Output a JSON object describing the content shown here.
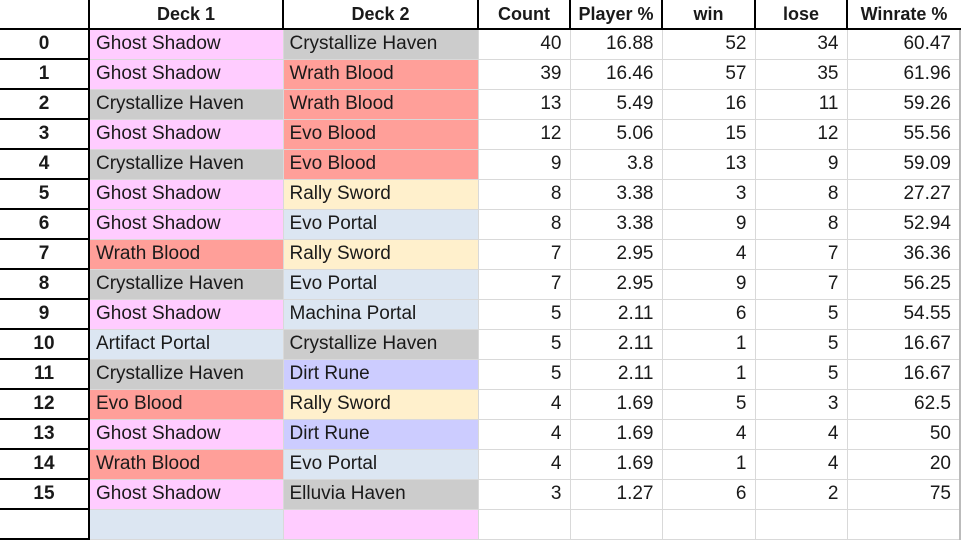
{
  "columns": [
    "",
    "Deck 1",
    "Deck 2",
    "Count",
    "Player %",
    "win",
    "lose",
    "Winrate %"
  ],
  "deck_colors": {
    "Ghost Shadow": "#ffccff",
    "Crystallize Haven": "#cccccc",
    "Wrath Blood": "#ff9f99",
    "Evo Blood": "#ff9f99",
    "Rally Sword": "#fff0cc",
    "Evo Portal": "#dce6f2",
    "Machina Portal": "#dce6f2",
    "Artifact Portal": "#dce6f2",
    "Dirt Rune": "#ccccff",
    "Elluvia Haven": "#cccccc"
  },
  "rows": [
    {
      "index": "0",
      "deck1": "Ghost Shadow",
      "deck2": "Crystallize Haven",
      "count": "40",
      "player_pct": "16.88",
      "win": "52",
      "lose": "34",
      "winrate": "60.47"
    },
    {
      "index": "1",
      "deck1": "Ghost Shadow",
      "deck2": "Wrath Blood",
      "count": "39",
      "player_pct": "16.46",
      "win": "57",
      "lose": "35",
      "winrate": "61.96"
    },
    {
      "index": "2",
      "deck1": "Crystallize Haven",
      "deck2": "Wrath Blood",
      "count": "13",
      "player_pct": "5.49",
      "win": "16",
      "lose": "11",
      "winrate": "59.26"
    },
    {
      "index": "3",
      "deck1": "Ghost Shadow",
      "deck2": "Evo Blood",
      "count": "12",
      "player_pct": "5.06",
      "win": "15",
      "lose": "12",
      "winrate": "55.56"
    },
    {
      "index": "4",
      "deck1": "Crystallize Haven",
      "deck2": "Evo Blood",
      "count": "9",
      "player_pct": "3.8",
      "win": "13",
      "lose": "9",
      "winrate": "59.09"
    },
    {
      "index": "5",
      "deck1": "Ghost Shadow",
      "deck2": "Rally Sword",
      "count": "8",
      "player_pct": "3.38",
      "win": "3",
      "lose": "8",
      "winrate": "27.27"
    },
    {
      "index": "6",
      "deck1": "Ghost Shadow",
      "deck2": "Evo Portal",
      "count": "8",
      "player_pct": "3.38",
      "win": "9",
      "lose": "8",
      "winrate": "52.94"
    },
    {
      "index": "7",
      "deck1": "Wrath Blood",
      "deck2": "Rally Sword",
      "count": "7",
      "player_pct": "2.95",
      "win": "4",
      "lose": "7",
      "winrate": "36.36"
    },
    {
      "index": "8",
      "deck1": "Crystallize Haven",
      "deck2": "Evo Portal",
      "count": "7",
      "player_pct": "2.95",
      "win": "9",
      "lose": "7",
      "winrate": "56.25"
    },
    {
      "index": "9",
      "deck1": "Ghost Shadow",
      "deck2": "Machina Portal",
      "count": "5",
      "player_pct": "2.11",
      "win": "6",
      "lose": "5",
      "winrate": "54.55"
    },
    {
      "index": "10",
      "deck1": "Artifact Portal",
      "deck2": "Crystallize Haven",
      "count": "5",
      "player_pct": "2.11",
      "win": "1",
      "lose": "5",
      "winrate": "16.67"
    },
    {
      "index": "11",
      "deck1": "Crystallize Haven",
      "deck2": "Dirt Rune",
      "count": "5",
      "player_pct": "2.11",
      "win": "1",
      "lose": "5",
      "winrate": "16.67"
    },
    {
      "index": "12",
      "deck1": "Evo Blood",
      "deck2": "Rally Sword",
      "count": "4",
      "player_pct": "1.69",
      "win": "5",
      "lose": "3",
      "winrate": "62.5"
    },
    {
      "index": "13",
      "deck1": "Ghost Shadow",
      "deck2": "Dirt Rune",
      "count": "4",
      "player_pct": "1.69",
      "win": "4",
      "lose": "4",
      "winrate": "50"
    },
    {
      "index": "14",
      "deck1": "Wrath Blood",
      "deck2": "Evo Portal",
      "count": "4",
      "player_pct": "1.69",
      "win": "1",
      "lose": "4",
      "winrate": "20"
    },
    {
      "index": "15",
      "deck1": "Ghost Shadow",
      "deck2": "Elluvia Haven",
      "count": "3",
      "player_pct": "1.27",
      "win": "6",
      "lose": "2",
      "winrate": "75"
    }
  ],
  "partial_row_colors": {
    "deck1": "#dce6f2",
    "deck2": "#ffccff"
  }
}
